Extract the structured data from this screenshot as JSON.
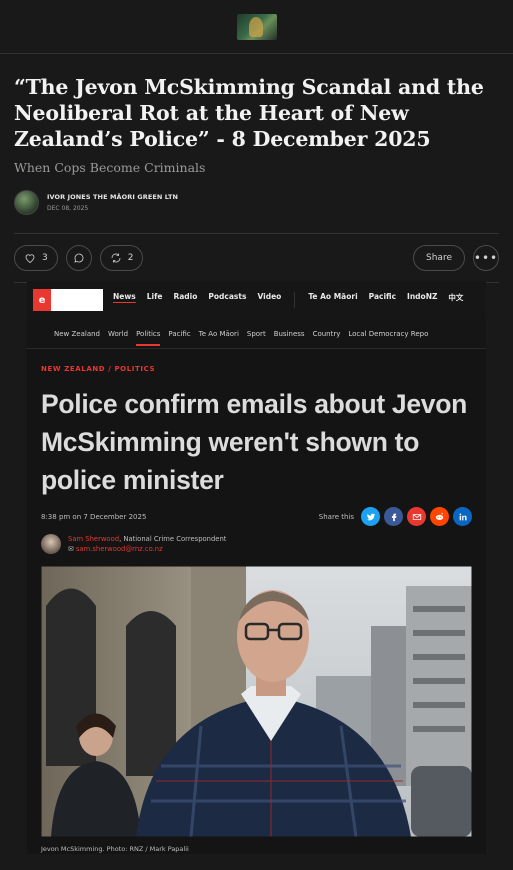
{
  "post": {
    "title": "“The Jevon McSkimming Scandal and the Neoliberal Rot at the Heart of New Zealand’s Police” - 8 December 2025",
    "subtitle": "When Cops Become Criminals",
    "author": "IVOR JONES THE MĀORI GREEN LTN",
    "date": "DEC 08, 2025"
  },
  "actions": {
    "likes": "3",
    "restacks": "2",
    "share_label": "Share",
    "more_label": "•••"
  },
  "embed": {
    "logo_letter": "e",
    "main_nav": [
      "News",
      "Life",
      "Radio",
      "Podcasts",
      "Video",
      "Te Ao Māori",
      "Pacific",
      "IndoNZ",
      "中文"
    ],
    "sub_nav": [
      "New Zealand",
      "World",
      "Politics",
      "Pacific",
      "Te Ao Māori",
      "Sport",
      "Business",
      "Country",
      "Local Democracy Repo"
    ],
    "kicker": "NEW ZEALAND / POLITICS",
    "headline": "Police confirm emails about Jevon McSkimming weren't shown to police minister",
    "timestamp": "8:38 pm on 7 December 2025",
    "share_this": "Share this",
    "byline_name": "Sam Sherwood",
    "byline_role": ", National Crime Correspondent",
    "byline_email": "sam.sherwood@rnz.co.nz",
    "caption": "Jevon McSkimming. Photo: RNZ / Mark Papalii"
  },
  "colors": {
    "rnz_red": "#e8382f",
    "twitter": "#1da1f2",
    "facebook": "#3b5998",
    "email": "#e8382f",
    "reddit": "#ff4500",
    "linkedin": "#0a66c2"
  }
}
